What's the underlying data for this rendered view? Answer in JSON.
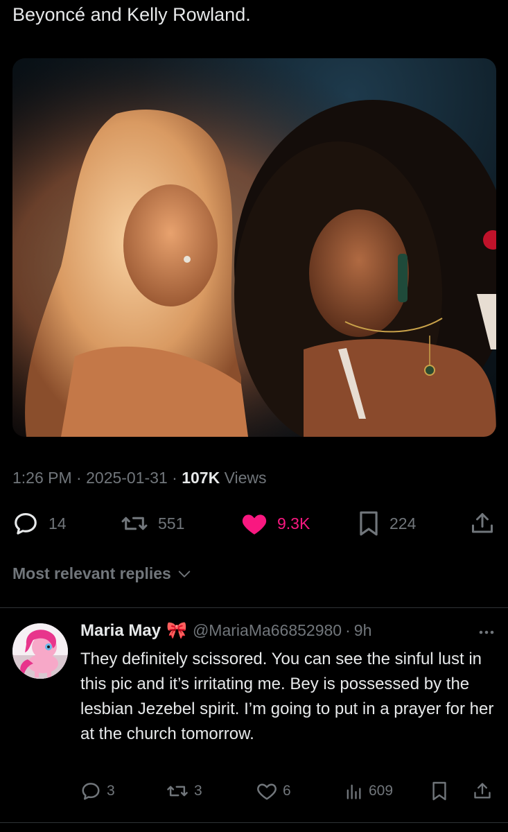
{
  "tweet": {
    "text": "Beyoncé and Kelly Rowland.",
    "time": "1:26 PM",
    "date": "2025-01-31",
    "views_count": "107K",
    "views_label": "Views",
    "separator": "·"
  },
  "actions": {
    "replies": "14",
    "reposts": "551",
    "likes": "9.3K",
    "bookmarks": "224"
  },
  "replies_sort": {
    "label": "Most relevant replies"
  },
  "reply": {
    "author_name": "Maria May",
    "author_emoji": "🎀",
    "handle": "@MariaMa66852980",
    "separator": "·",
    "time": "9h",
    "text": "They definitely scissored. You can see the sinful lust in this pic and it’s irritating me. Bey is possessed by the lesbian Jezebel spirit. I’m going to put in a prayer for her at the church tomorrow.",
    "replies": "3",
    "reposts": "3",
    "likes": "6",
    "views": "609"
  },
  "colors": {
    "background": "#000000",
    "text": "#e7e9ea",
    "muted": "#71767b",
    "like": "#f91880",
    "divider": "#2f3336"
  },
  "icons": {
    "reply": "speech-bubble",
    "repost": "loop-arrows",
    "like": "heart",
    "bookmark": "bookmark",
    "share": "upload-arrow",
    "views": "bar-chart",
    "more": "three-dots"
  }
}
